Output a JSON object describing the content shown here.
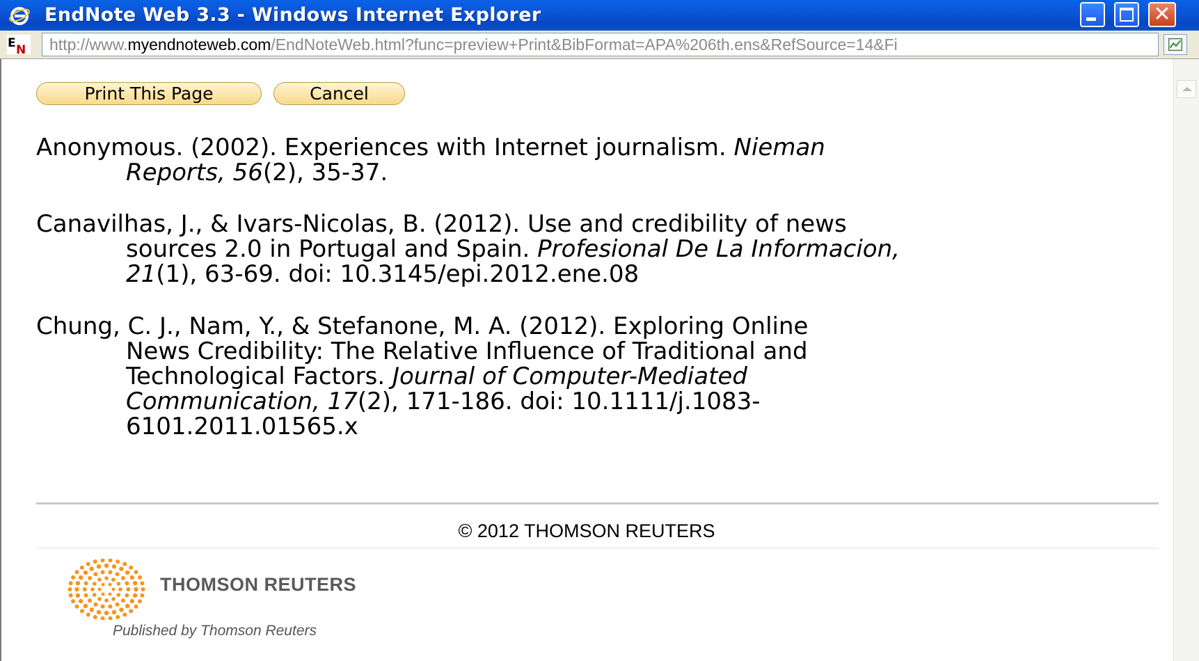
{
  "window": {
    "title": "EndNote Web 3.3 - Windows Internet Explorer",
    "title_bar_color": "#0b55d8"
  },
  "address_bar": {
    "url_prefix": "http://www.",
    "url_domain": "myendnoteweb.com",
    "url_path": "/EndNoteWeb.html?func=preview+Print&BibFormat=APA%206th.ens&RefSource=14&Fi"
  },
  "toolbar": {
    "print_label": "Print This Page",
    "cancel_label": "Cancel"
  },
  "references": [
    {
      "line1": "Anonymous. (2002). Experiences with Internet journalism. ",
      "line1_italic": "Nieman",
      "line2_italic": "Reports, 56",
      "line2_rest": "(2), 35-37."
    },
    {
      "line1": "Canavilhas, J., & Ivars-Nicolas, B. (2012). Use and credibility of news",
      "line2": "sources 2.0 in Portugal and Spain. ",
      "line2_italic": "Profesional De La Informacion,",
      "line3_italic": "21",
      "line3_rest": "(1), 63-69. doi: 10.3145/epi.2012.ene.08"
    },
    {
      "line1": "Chung, C. J., Nam, Y., & Stefanone, M. A. (2012). Exploring Online",
      "line2": "News Credibility: The Relative Influence of Traditional and",
      "line3": "Technological Factors. ",
      "line3_italic": "Journal of Computer-Mediated",
      "line4_italic": "Communication, 17",
      "line4_rest": "(2), 171-186. doi: 10.1111/j.1083-",
      "line5": "6101.2011.01565.x"
    }
  ],
  "footer": {
    "copyright": "© 2012 THOMSON REUTERS",
    "brand": "THOMSON REUTERS",
    "published": "Published by Thomson Reuters",
    "logo_color": "#f7941d"
  }
}
